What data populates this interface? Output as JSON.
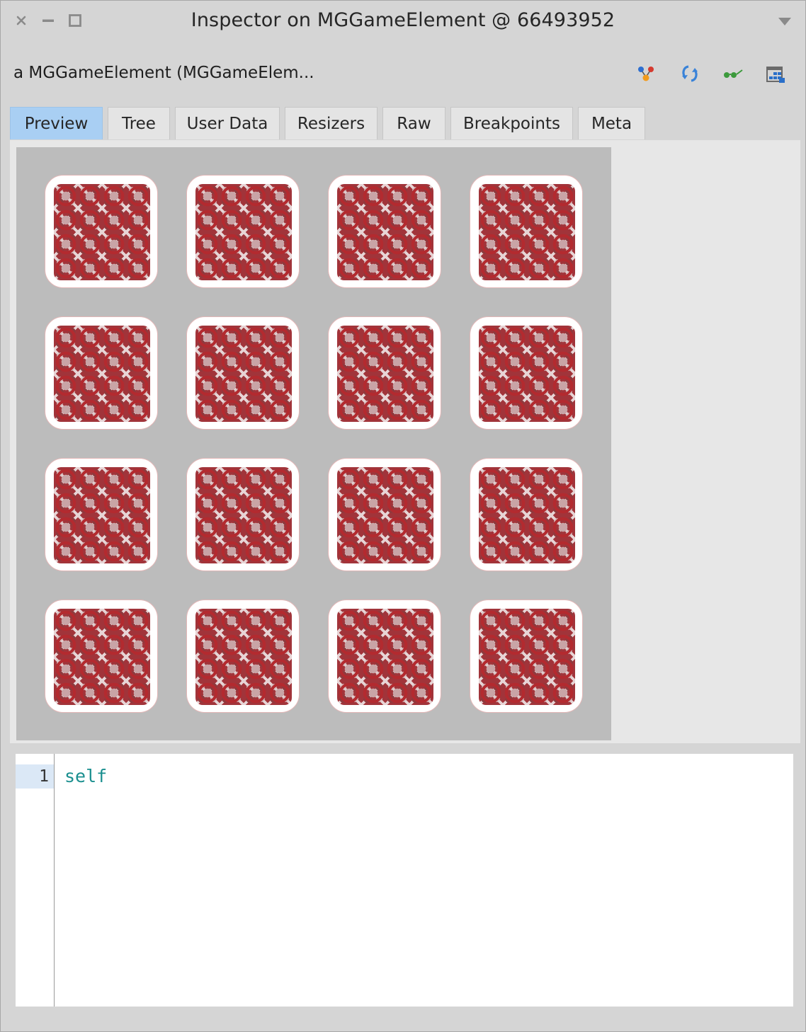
{
  "window": {
    "title": "Inspector on MGGameElement @ 66493952",
    "close_icon": "close-icon",
    "minimize_icon": "minimize-icon",
    "maximize_icon": "maximize-icon",
    "menu_icon": "chevron-down-icon"
  },
  "header": {
    "object_label": "a MGGameElement (MGGameElem...",
    "toolbar_icons": [
      "browse-icon",
      "refresh-icon",
      "inspect-glasses-icon",
      "calendar-grid-icon"
    ]
  },
  "tabs": [
    {
      "label": "Preview",
      "active": true
    },
    {
      "label": "Tree",
      "active": false
    },
    {
      "label": "User Data",
      "active": false
    },
    {
      "label": "Resizers",
      "active": false
    },
    {
      "label": "Raw",
      "active": false
    },
    {
      "label": "Breakpoints",
      "active": false
    },
    {
      "label": "Meta",
      "active": false
    }
  ],
  "preview": {
    "rows": 4,
    "columns": 4,
    "card_face": "face-down",
    "board_color": "#bcbcbc",
    "card_pattern_color": "#a1343a"
  },
  "editor": {
    "lines": [
      {
        "number": "1",
        "code": "self"
      }
    ]
  },
  "colors": {
    "active_tab": "#a9cff3",
    "code_text": "#1a8f8f"
  }
}
